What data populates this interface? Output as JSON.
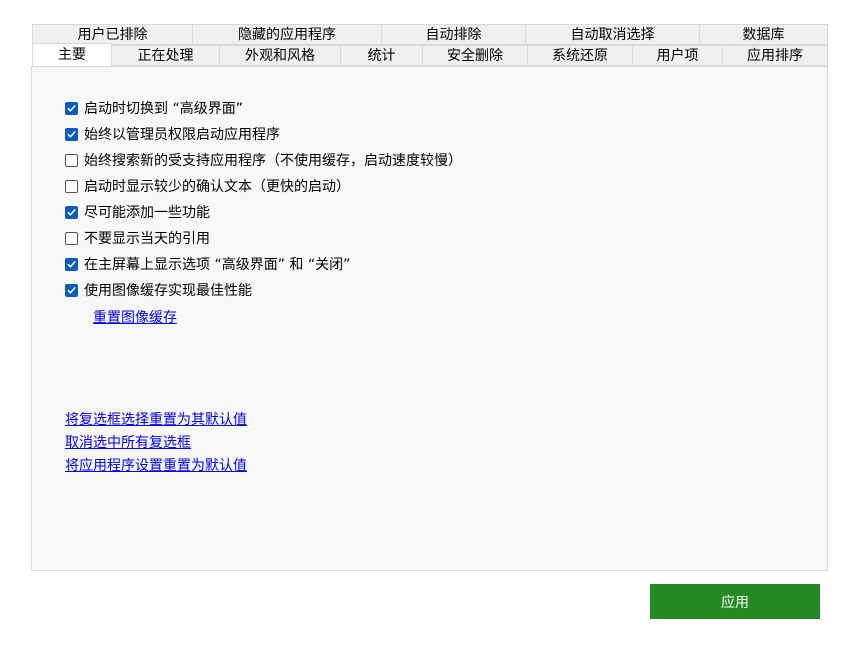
{
  "tabs_back": [
    "用户已排除",
    "隐藏的应用程序",
    "自动排除",
    "自动取消选择",
    "数据库"
  ],
  "tabs_front": [
    "主要",
    "正在处理",
    "外观和风格",
    "统计",
    "安全删除",
    "系统还原",
    "用户项",
    "应用排序"
  ],
  "active_tab": "主要",
  "options": [
    {
      "label": "启动时切换到 “高级界面”",
      "checked": true
    },
    {
      "label": "始终以管理员权限启动应用程序",
      "checked": true
    },
    {
      "label": "始终搜索新的受支持应用程序（不使用缓存，启动速度较慢）",
      "checked": false
    },
    {
      "label": "启动时显示较少的确认文本（更快的启动）",
      "checked": false
    },
    {
      "label": "尽可能添加一些功能",
      "checked": true
    },
    {
      "label": "不要显示当天的引用",
      "checked": false
    },
    {
      "label": "在主屏幕上显示选项 “高级界面” 和 “关闭”",
      "checked": true
    },
    {
      "label": "使用图像缓存实现最佳性能",
      "checked": true
    }
  ],
  "reset_image_cache_link": "重置图像缓存",
  "links": {
    "reset_checkboxes": "将复选框选择重置为其默认值",
    "uncheck_all": "取消选中所有复选框",
    "reset_app_settings": "将应用程序设置重置为默认值"
  },
  "apply_button": "应用",
  "colors": {
    "accent_checkbox": "#0a5cbe",
    "apply_button": "#238b22",
    "link": "#0000ee"
  }
}
